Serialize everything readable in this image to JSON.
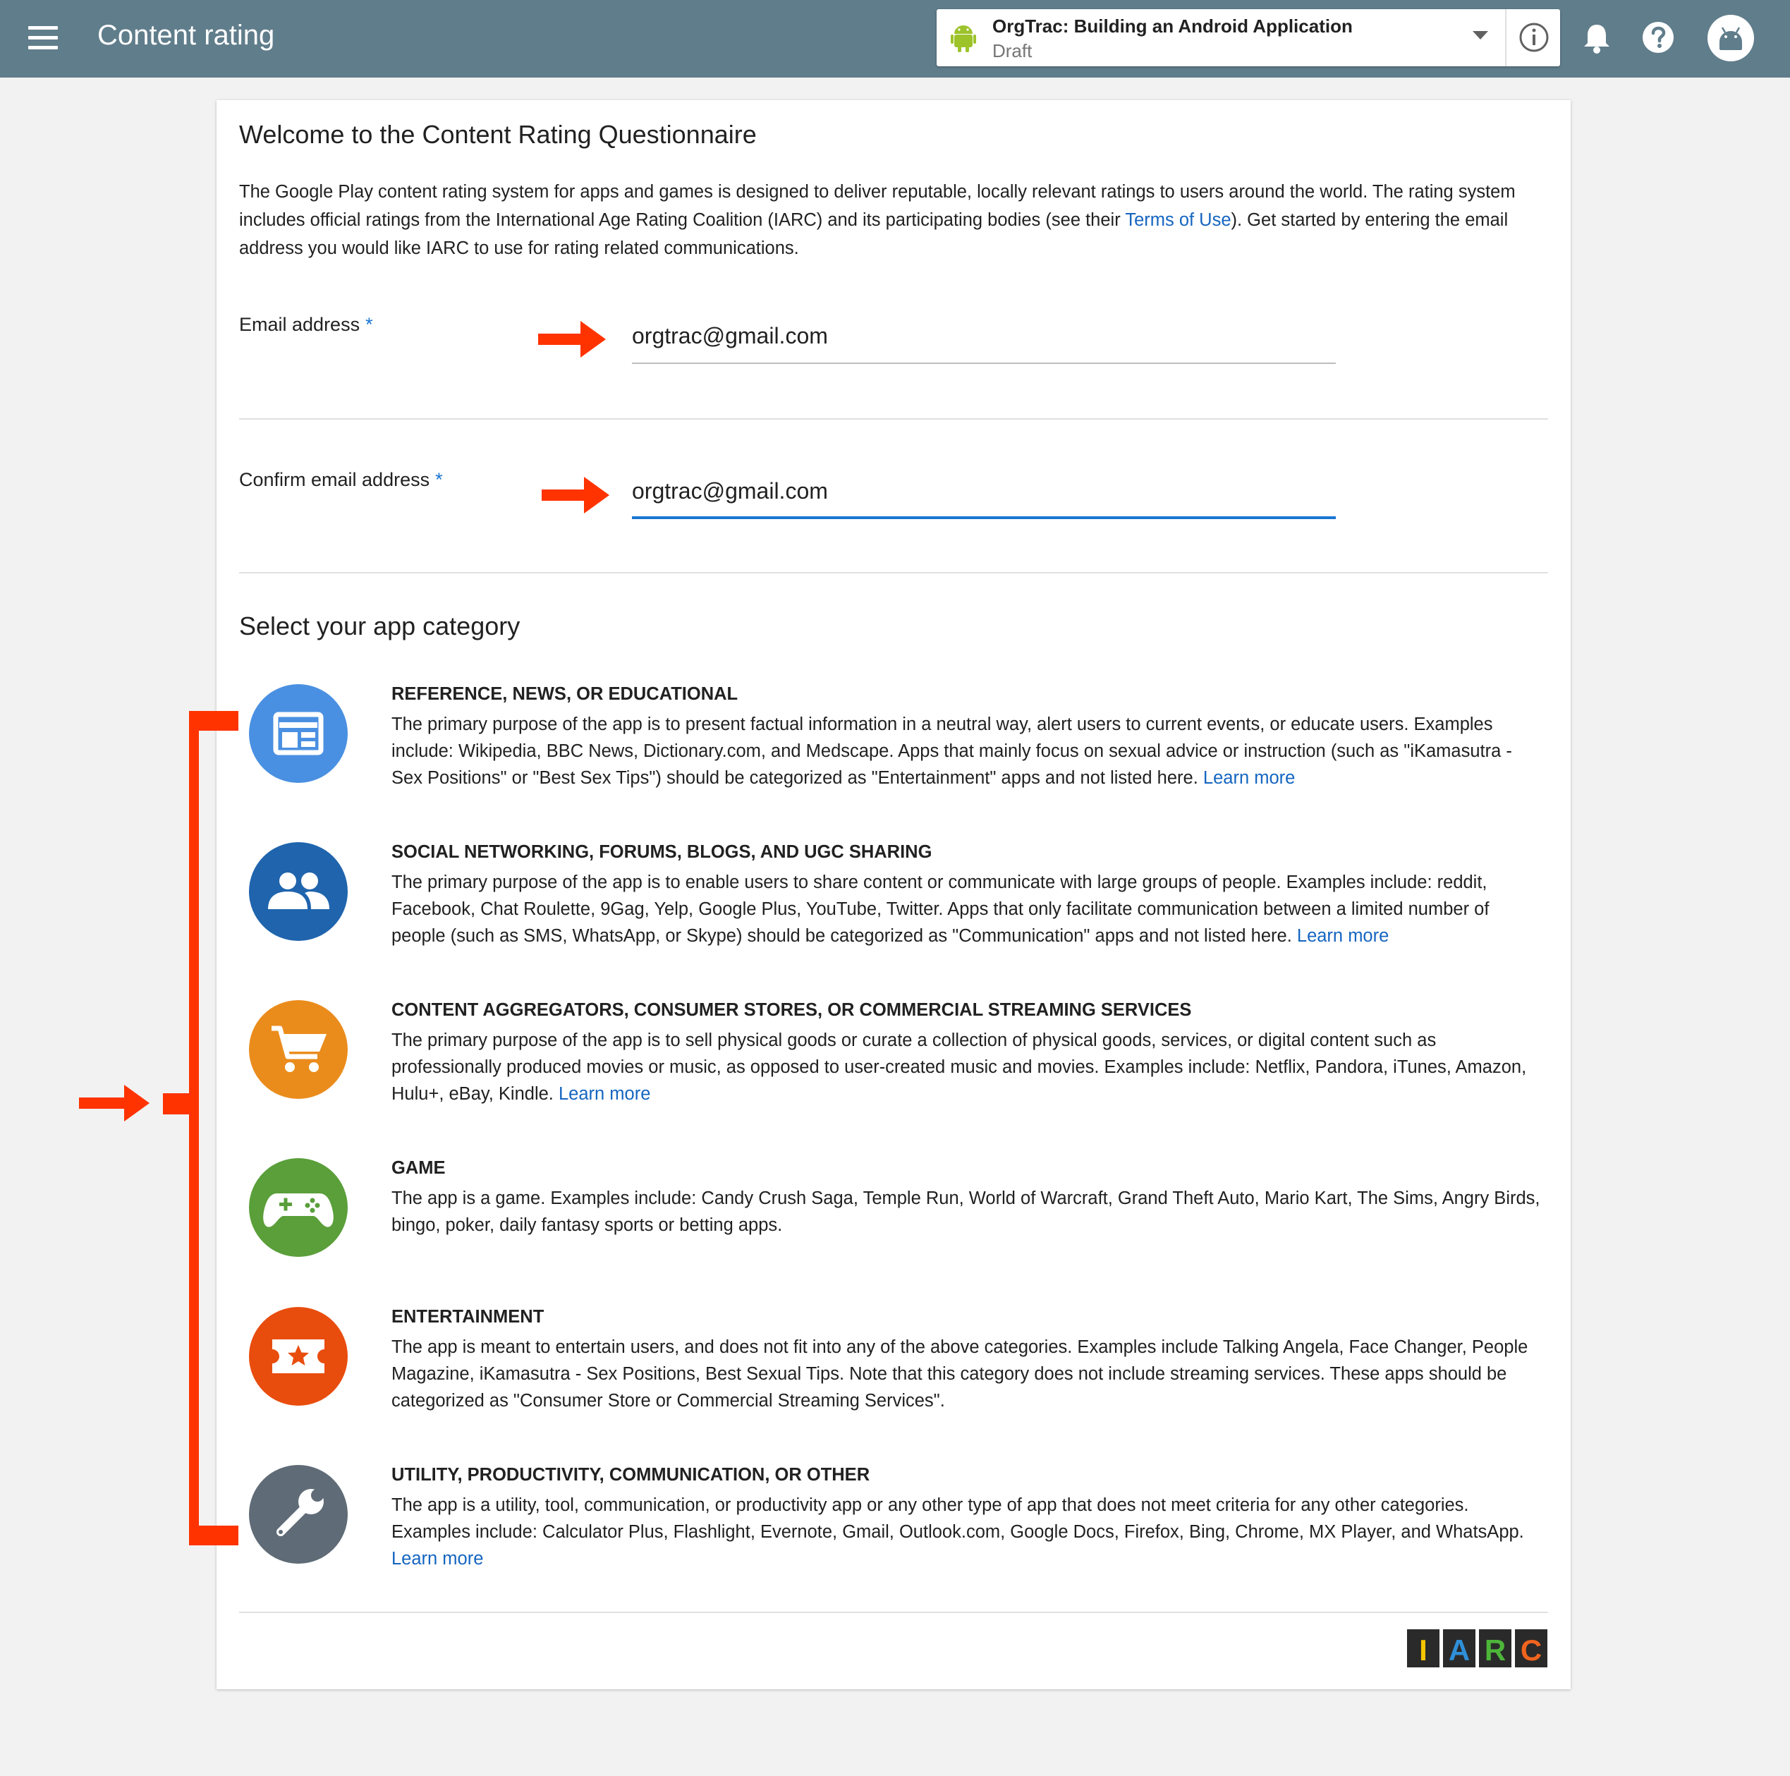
{
  "topbar": {
    "menu_icon": "menu-icon",
    "title": "Content rating",
    "app_name": "OrgTrac: Building an Android Application",
    "app_status": "Draft",
    "icons": [
      "android-icon",
      "dropdown-caret-icon",
      "info-icon",
      "bell-icon",
      "help-icon",
      "avatar-icon"
    ]
  },
  "intro": {
    "heading": "Welcome to the Content Rating Questionnaire",
    "text_before": "The Google Play content rating system for apps and games is designed to deliver reputable, locally relevant ratings to users around the world. The rating system includes official ratings from the International Age Rating Coalition (IARC) and its participating bodies (see their ",
    "terms_link": "Terms of Use",
    "text_after": "). Get started by entering the email address you would like IARC to use for rating related communications."
  },
  "email": {
    "label": "Email address",
    "required_mark": "*",
    "value": "orgtrac@gmail.com"
  },
  "confirm_email": {
    "label": "Confirm email address",
    "required_mark": "*",
    "value": "orgtrac@gmail.com"
  },
  "category_section": {
    "heading": "Select your app category",
    "categories": [
      {
        "title": "REFERENCE, NEWS, OR EDUCATIONAL",
        "desc": "The primary purpose of the app is to present factual information in a neutral way, alert users to current events, or educate users. Examples include: Wikipedia, BBC News, Dictionary.com, and Medscape. Apps that mainly focus on sexual advice or instruction (such as \"iKamasutra - Sex Positions\" or \"Best Sex Tips\") should be categorized as \"Entertainment\" apps and not listed here.",
        "link": "Learn more",
        "icon": "news-icon",
        "color": "#4a90e2"
      },
      {
        "title": "SOCIAL NETWORKING, FORUMS, BLOGS, AND UGC SHARING",
        "desc": "The primary purpose of the app is to enable users to share content or communicate with large groups of people. Examples include: reddit, Facebook, Chat Roulette, 9Gag, Yelp, Google Plus, YouTube, Twitter. Apps that only facilitate communication between a limited number of people (such as SMS, WhatsApp, or Skype) should be categorized as \"Communication\" apps and not listed here.",
        "link": "Learn more",
        "icon": "people-icon",
        "color": "#1f64ad"
      },
      {
        "title": "CONTENT AGGREGATORS, CONSUMER STORES, OR COMMERCIAL STREAMING SERVICES",
        "desc": "The primary purpose of the app is to sell physical goods or curate a collection of physical goods, services, or digital content such as professionally produced movies or music, as opposed to user-created music and movies. Examples include: Netflix, Pandora, iTunes, Amazon, Hulu+, eBay, Kindle.",
        "link": "Learn more",
        "icon": "shopping-cart-icon",
        "color": "#ea8c1c"
      },
      {
        "title": "GAME",
        "desc": "The app is a game. Examples include: Candy Crush Saga, Temple Run, World of Warcraft, Grand Theft Auto, Mario Kart, The Sims, Angry Birds, bingo, poker, daily fantasy sports or betting apps.",
        "link": "",
        "icon": "gamepad-icon",
        "color": "#5a9f3a"
      },
      {
        "title": "ENTERTAINMENT",
        "desc": "The app is meant to entertain users, and does not fit into any of the above categories. Examples include Talking Angela, Face Changer, People Magazine, iKamasutra - Sex Positions, Best Sexual Tips. Note that this category does not include streaming services. These apps should be categorized as \"Consumer Store or Commercial Streaming Services\".",
        "link": "",
        "icon": "ticket-star-icon",
        "color": "#e84d0e"
      },
      {
        "title": "UTILITY, PRODUCTIVITY, COMMUNICATION, OR OTHER",
        "desc": "The app is a utility, tool, communication, or productivity app or any other type of app that does not meet criteria for any other categories. Examples include: Calculator Plus, Flashlight, Evernote, Gmail, Outlook.com, Google Docs, Firefox, Bing, Chrome, MX Player, and WhatsApp.",
        "link": "Learn more",
        "icon": "wrench-icon",
        "color": "#5f6b76"
      }
    ]
  },
  "iarc_logo": {
    "letters": [
      "I",
      "A",
      "R",
      "C"
    ],
    "colors": [
      "#f5c400",
      "#2f8fd8",
      "#4db53a",
      "#f0641e"
    ]
  },
  "annotation_color": "#ff3300"
}
